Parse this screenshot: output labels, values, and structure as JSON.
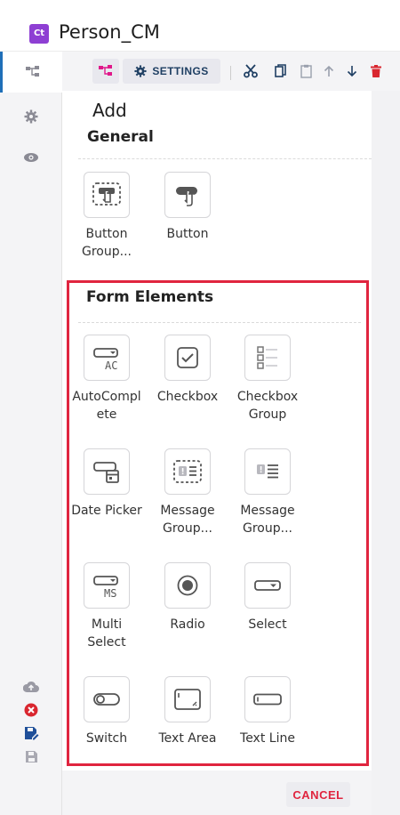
{
  "app": {
    "badge": "Ct",
    "title": "Person_CM"
  },
  "toolbar": {
    "settings_label": "SETTINGS"
  },
  "panel": {
    "title": "Add",
    "general": {
      "heading": "General",
      "items": [
        {
          "label": "Button Group...",
          "icon": "button-group-icon"
        },
        {
          "label": "Button",
          "icon": "button-icon"
        }
      ]
    },
    "form_elements": {
      "heading": "Form Elements",
      "items": [
        {
          "label": "AutoComplete",
          "icon": "autocomplete-icon"
        },
        {
          "label": "Checkbox",
          "icon": "checkbox-icon"
        },
        {
          "label": "Checkbox Group",
          "icon": "checkbox-group-icon"
        },
        {
          "label": "Date Picker",
          "icon": "date-picker-icon"
        },
        {
          "label": "Message Group...",
          "icon": "message-group-icon"
        },
        {
          "label": "Message Group...",
          "icon": "message-group-alt-icon"
        },
        {
          "label": "Multi Select",
          "icon": "multi-select-icon"
        },
        {
          "label": "Radio",
          "icon": "radio-icon"
        },
        {
          "label": "Select",
          "icon": "select-icon"
        },
        {
          "label": "Switch",
          "icon": "switch-icon"
        },
        {
          "label": "Text Area",
          "icon": "text-area-icon"
        },
        {
          "label": "Text Line",
          "icon": "text-line-icon"
        }
      ]
    },
    "cancel_label": "CANCEL"
  },
  "colors": {
    "accent": "#1f6fb8",
    "highlight": "#e0253f",
    "brand": "#8e3fd3",
    "pink": "#e0188a"
  }
}
